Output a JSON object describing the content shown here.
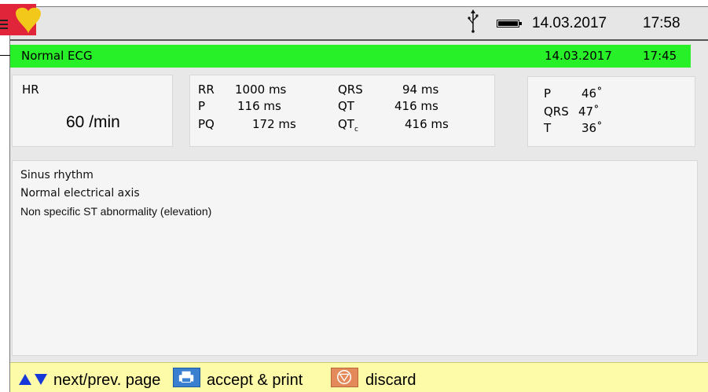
{
  "status_bar": {
    "date": "14.03.2017",
    "time": "17:58",
    "icons": [
      "menu-icon",
      "heart-logo-icon",
      "usb-icon",
      "battery-icon"
    ]
  },
  "record": {
    "title": "Normal ECG",
    "date": "14.03.2017",
    "time": "17:45",
    "accent_color": "#28f028"
  },
  "heart_rate": {
    "label": "HR",
    "value": "60 /min"
  },
  "intervals": {
    "rr": {
      "label": "RR",
      "value": "1000 ms"
    },
    "p": {
      "label": "P",
      "value": "116 ms"
    },
    "pq": {
      "label": "PQ",
      "value": "172 ms"
    },
    "qrs": {
      "label": "QRS",
      "value": "94 ms"
    },
    "qt": {
      "label": "QT",
      "value": "416 ms"
    },
    "qtc": {
      "label": "QT",
      "sub": "c",
      "value": "416 ms"
    }
  },
  "axes": {
    "p": {
      "label": "P",
      "value": "46˚"
    },
    "qrs": {
      "label": "QRS",
      "value": "47˚"
    },
    "t": {
      "label": "T",
      "value": "36˚"
    }
  },
  "interpretation": [
    "Sinus rhythm",
    "Normal electrical axis",
    "Non specific ST abnormality (elevation)"
  ],
  "footer": {
    "nav_label": "next/prev. page",
    "print_label": "accept & print",
    "discard_label": "discard",
    "background": "#fdfaa8"
  }
}
